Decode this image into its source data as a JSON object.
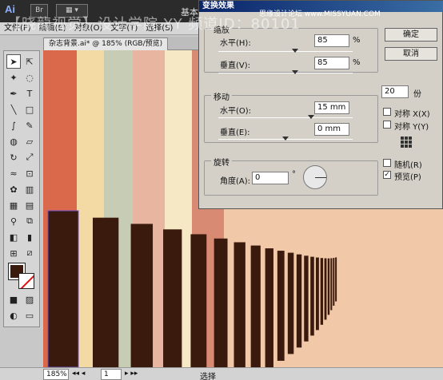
{
  "app": {
    "logo": "Ai",
    "br_badge": "Br",
    "workspace_label": "基本I",
    "site_mark": "思缘设计论坛 www.MISSYUAN.COM",
    "watermark": "【晓龍视觉】设计学院  YY 频道ID：80101"
  },
  "menu": {
    "items": [
      "文件(F)",
      "编辑(E)",
      "对象(O)",
      "文字(T)",
      "选择(S)"
    ]
  },
  "document_tab": {
    "title": "杂志背景.ai* @ 185% (RGB/预览)"
  },
  "status": {
    "zoom": "185%",
    "page": "1",
    "text": "选择"
  },
  "dialog": {
    "title": "变换效果",
    "scale": {
      "label": "缩放",
      "horizontal_label": "水平(H):",
      "horizontal_value": "85",
      "vertical_label": "垂直(V):",
      "vertical_value": "85",
      "unit": "%"
    },
    "move": {
      "label": "移动",
      "horizontal_label": "水平(O):",
      "horizontal_value": "15 mm",
      "vertical_label": "垂直(E):",
      "vertical_value": "0 mm"
    },
    "rotate": {
      "label": "旋转",
      "angle_label": "角度(A):",
      "angle_value": "0",
      "degree": "°"
    },
    "ok_label": "确定",
    "cancel_label": "取消",
    "copies_value": "20",
    "copies_label": "份",
    "reflect_x_label": "对称 X(X)",
    "reflect_y_label": "对称 Y(Y)",
    "random_label": "随机(R)",
    "preview_label": "预览(P)",
    "preview_checked": true,
    "reflect_x_checked": false,
    "reflect_y_checked": false,
    "random_checked": false
  },
  "colors": {
    "fill": "#3b1a0e",
    "bar": "#3b1a0e",
    "stripes": [
      "#d9694a",
      "#f3d9a4",
      "#c6cdb4",
      "#e8b6a0",
      "#f6e7c5",
      "#d98a72",
      "#f1c9a8"
    ]
  },
  "transform_preview": {
    "scale_factor": 0.85,
    "copies": 20
  }
}
